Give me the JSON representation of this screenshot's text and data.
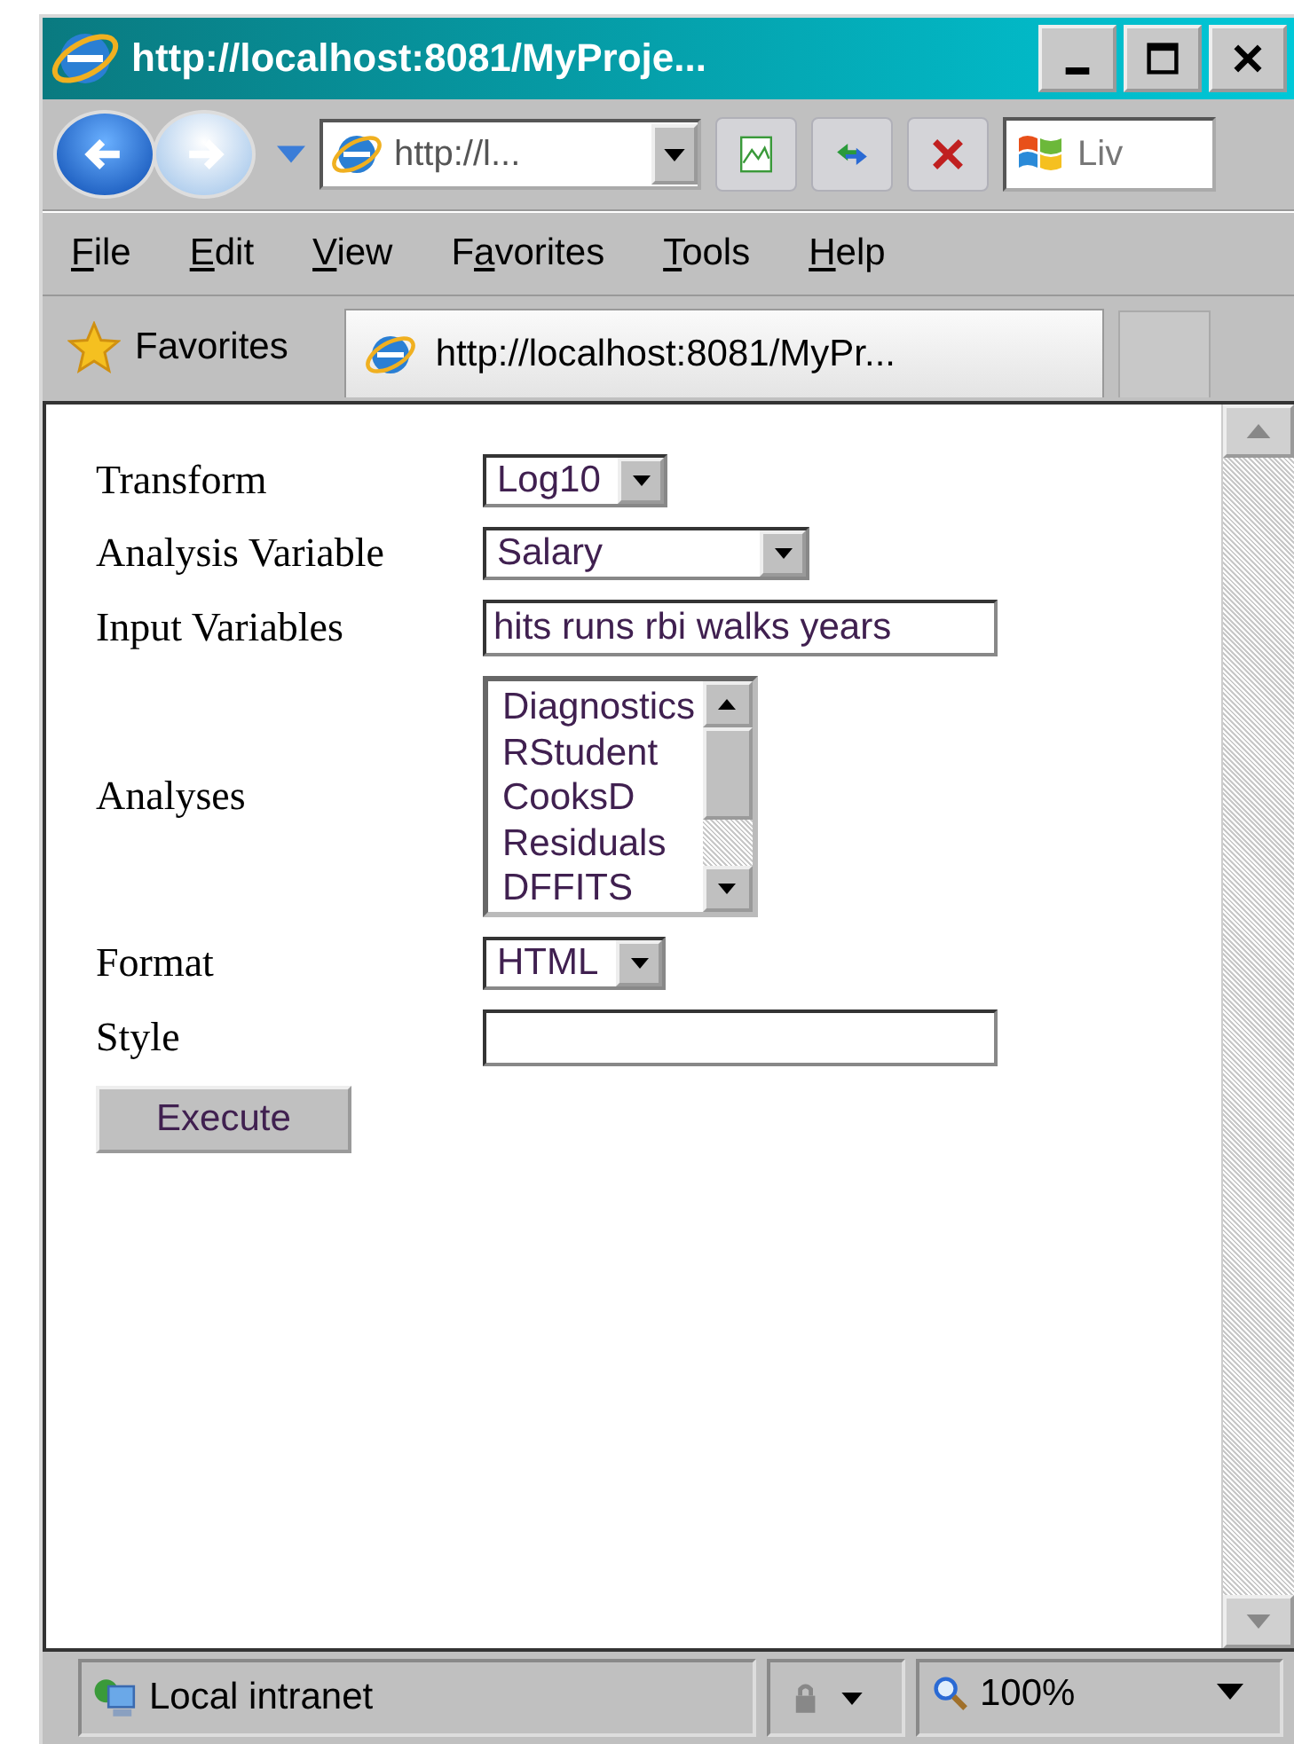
{
  "window": {
    "title": "http://localhost:8081/MyProje..."
  },
  "toolbar": {
    "address": "http://l...",
    "search": "Liv"
  },
  "menu": [
    {
      "key": "F",
      "after": "ile"
    },
    {
      "key": "E",
      "after": "dit"
    },
    {
      "key": "V",
      "after": "iew"
    },
    {
      "before": "F",
      "key": "a",
      "after": "vorites"
    },
    {
      "key": "T",
      "after": "ools"
    },
    {
      "key": "H",
      "after": "elp"
    }
  ],
  "favorites_bar": {
    "label": "Favorites",
    "tab": "http://localhost:8081/MyPr..."
  },
  "form": [
    {
      "kind": "select",
      "label": "Transform",
      "value": "Log10"
    },
    {
      "kind": "select",
      "label": "Analysis Variable",
      "value": "Salary"
    },
    {
      "kind": "text",
      "label": "Input Variables",
      "value": "hits runs rbi walks years"
    },
    {
      "kind": "listbox",
      "label": "Analyses",
      "options": [
        {
          "text": "Diagnostics",
          "selected": false
        },
        {
          "text": "RStudent",
          "selected": false
        },
        {
          "text": "CooksD",
          "selected": false
        },
        {
          "text": "Residuals",
          "selected": false
        },
        {
          "text": "DFFITS",
          "selected": false
        }
      ]
    },
    {
      "kind": "select",
      "label": "Format",
      "value": "HTML"
    },
    {
      "kind": "text",
      "label": "Style"
    },
    {
      "kind": "button",
      "label": "Execute"
    }
  ],
  "status_bar": {
    "zone": "Local intranet",
    "zoom": "100%"
  }
}
